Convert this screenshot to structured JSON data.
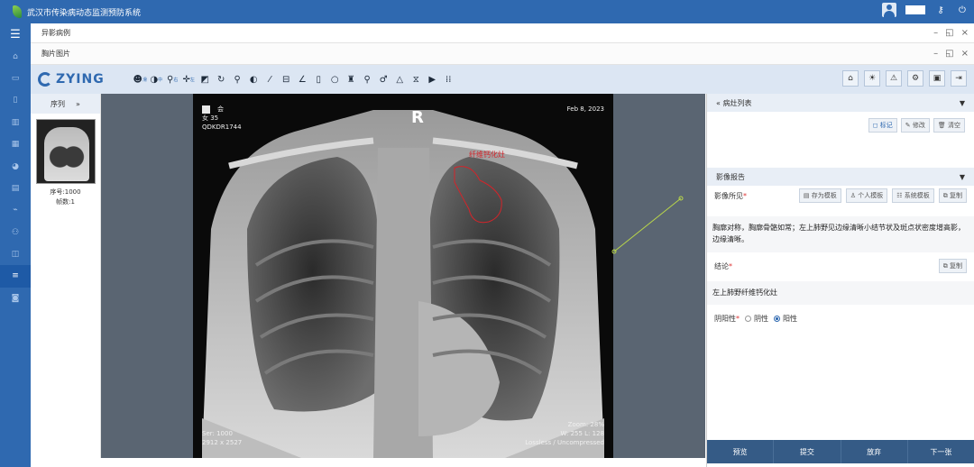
{
  "app": {
    "title": "武汉市传染病动态监测预防系统"
  },
  "titlebar": {
    "icons": [
      "user-avatar",
      "key-icon",
      "power-icon"
    ]
  },
  "sidebar": {
    "icons": [
      "menu-icon",
      "home-icon",
      "monitor-icon",
      "clipboard-icon",
      "bar-chart-icon",
      "bar-chart-icon",
      "pie-chart-icon",
      "bar-chart-icon",
      "line-chart-icon",
      "users-icon",
      "window-icon",
      "list-icon",
      "camera-icon"
    ]
  },
  "panel1": {
    "title": "异影病例"
  },
  "panel2": {
    "title": "胸片图片"
  },
  "toolbar": {
    "brand": "ZYING",
    "tool_icons": [
      "brightness-icon",
      "contrast-icon",
      "zoom-icon",
      "crosshair-icon",
      "invert-icon",
      "rotate-icon",
      "search-icon",
      "adjust-icon",
      "ruler-icon",
      "measure-icon",
      "angle-icon",
      "rect-icon",
      "ellipse-icon",
      "tower-icon",
      "pin-icon",
      "cobb-icon",
      "triangle-icon",
      "hourglass-icon",
      "play-icon",
      "grid-icon"
    ],
    "tool_sups": [
      "滑",
      "中",
      "右",
      "左"
    ],
    "right_icons": [
      "home-icon",
      "sun-icon",
      "warning-icon",
      "settings-icon",
      "save-icon",
      "logout-icon"
    ]
  },
  "series": {
    "header": "序列",
    "toggle": "»",
    "item": {
      "seq_label": "序号:1000",
      "frames_label": "帧数:1"
    }
  },
  "viewer": {
    "top_left": {
      "name": "会",
      "sex_age": "女  35",
      "patient_id": "QDKDR1744"
    },
    "top_right": {
      "date": "Feb 8, 2023"
    },
    "bottom_left": {
      "series": "Ser: 1000",
      "size": "2912 x 2527"
    },
    "bottom_right": {
      "zoom": "Zoom: 28%",
      "window": "W: 255 L: 128",
      "compression": "Lossless / Uncompressed"
    },
    "side_marker": "R",
    "annotation": "纤维钙化灶"
  },
  "report": {
    "lesion_header": "病灶列表",
    "lesion_toggle": "«",
    "lesion_buttons": {
      "mark": "标记",
      "edit": "修改",
      "clear": "清空"
    },
    "report_header": "影像报告",
    "findings_label": "影像所见",
    "template_buttons": {
      "save": "存为模板",
      "personal": "个人模板",
      "system": "系统模板",
      "copy": "复制"
    },
    "findings_text": "胸廓对称，胸廓骨骼如常；左上肺野见边缘清晰小结节状及斑点状密度增高影，边缘清晰。",
    "conclusion_label": "结论",
    "conclusion_copy": "复制",
    "conclusion_text": "左上肺野纤维钙化灶",
    "polarity_label": "阴阳性",
    "polarity_options": {
      "negative": "阴性",
      "positive": "阳性"
    },
    "polarity_selected": "阳性",
    "footer_buttons": {
      "preview": "预览",
      "submit": "提交",
      "abandon": "放弃",
      "next": "下一张"
    }
  },
  "colors": {
    "primary": "#2f69b0",
    "toolbar_bg": "#dce6f3",
    "annotation": "#d3242a",
    "measure": "#b9d64a",
    "footer": "#355b86"
  }
}
